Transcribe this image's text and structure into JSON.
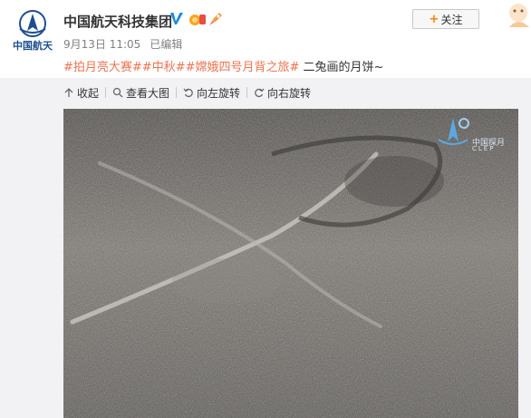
{
  "post": {
    "avatar_caption": "中国航天",
    "username": "中国航天科技集团",
    "date": "9月13日 11:05",
    "edited_label": "已编辑",
    "follow_label": "关注",
    "tags": [
      "#拍月亮大赛#",
      "#中秋#",
      "#嫦娥四号月背之旅#"
    ],
    "text": " 二兔画的月饼~"
  },
  "toolbar": {
    "collapse_label": "收起",
    "view_large_label": "查看大图",
    "rotate_left_label": "向左旋转",
    "rotate_right_label": "向右旋转"
  },
  "watermark": {
    "cn": "中国探月",
    "en": "CLEP"
  },
  "colors": {
    "tag": "#eb7350",
    "follow_plus": "#ff8200",
    "brand_blue": "#1d4e8f",
    "panel_bg": "#f2f2f5"
  },
  "icons": [
    "casc-logo-icon",
    "verified-v-icon",
    "medal-icon",
    "rocket-icon",
    "collapse-icon",
    "zoom-icon",
    "rotate-left-icon",
    "rotate-right-icon",
    "clep-logo-icon"
  ]
}
